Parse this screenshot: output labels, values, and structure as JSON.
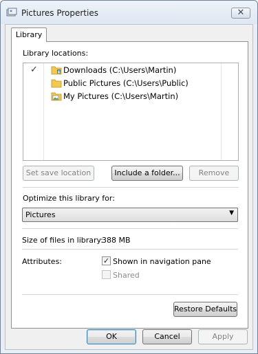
{
  "window": {
    "title": "Pictures Properties",
    "close_glyph": "✕"
  },
  "tabs": [
    {
      "label": "Library",
      "selected": true
    }
  ],
  "library": {
    "locations_label": "Library locations:",
    "locations": [
      {
        "checked": true,
        "check_glyph": "✓",
        "icon": "downloads-folder-icon",
        "text": "Downloads (C:\\Users\\Martin)"
      },
      {
        "checked": false,
        "icon": "folder-icon",
        "text": "Public Pictures (C:\\Users\\Public)"
      },
      {
        "checked": false,
        "icon": "pictures-folder-icon",
        "text": "My Pictures (C:\\Users\\Martin)"
      }
    ],
    "set_save_location_label": "Set save location",
    "include_folder_label": "Include a folder...",
    "remove_label": "Remove",
    "optimize_label": "Optimize this library for:",
    "optimize_value": "Pictures",
    "size_label": "Size of files in library:",
    "size_value": "388 MB",
    "attributes_label": "Attributes:",
    "shown_in_nav_label": "Shown in navigation pane",
    "shown_in_nav_checked": true,
    "shared_label": "Shared",
    "shared_checked": false,
    "restore_defaults_label": "Restore Defaults"
  },
  "footer": {
    "ok_label": "OK",
    "cancel_label": "Cancel",
    "apply_label": "Apply"
  },
  "colors": {
    "folder": "#f2c94c",
    "window_frame": "#e9eef5"
  }
}
